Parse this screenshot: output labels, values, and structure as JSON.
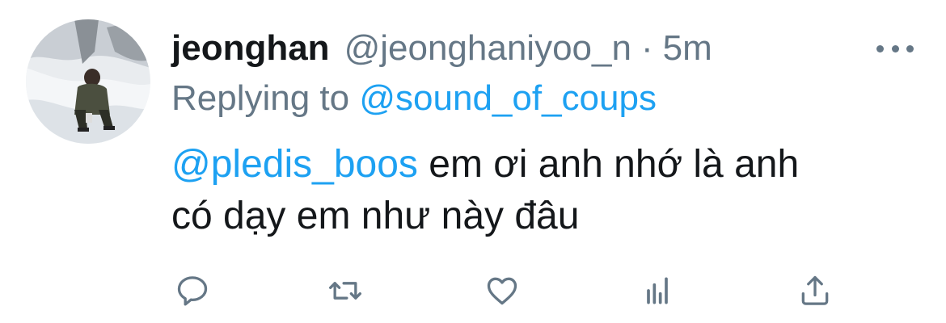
{
  "tweet": {
    "author": {
      "display_name": "jeonghan",
      "handle": "@jeonghaniyoo_n",
      "separator": "·",
      "time": "5m"
    },
    "reply": {
      "prefix": "Replying to",
      "mention": "@sound_of_coups"
    },
    "body": {
      "mention": "@pledis_boos",
      "line1_text": "em ơi anh nhớ là anh",
      "line2_text": "có dạy em như này đâu"
    }
  },
  "icons": {
    "more": "more-dots-icon",
    "reply": "reply-icon",
    "retweet": "retweet-icon",
    "like": "heart-icon",
    "analytics": "analytics-icon",
    "share": "share-icon"
  },
  "colors": {
    "text": "#14171a",
    "secondary": "#657786",
    "link": "#1da1f2",
    "background": "#ffffff"
  }
}
